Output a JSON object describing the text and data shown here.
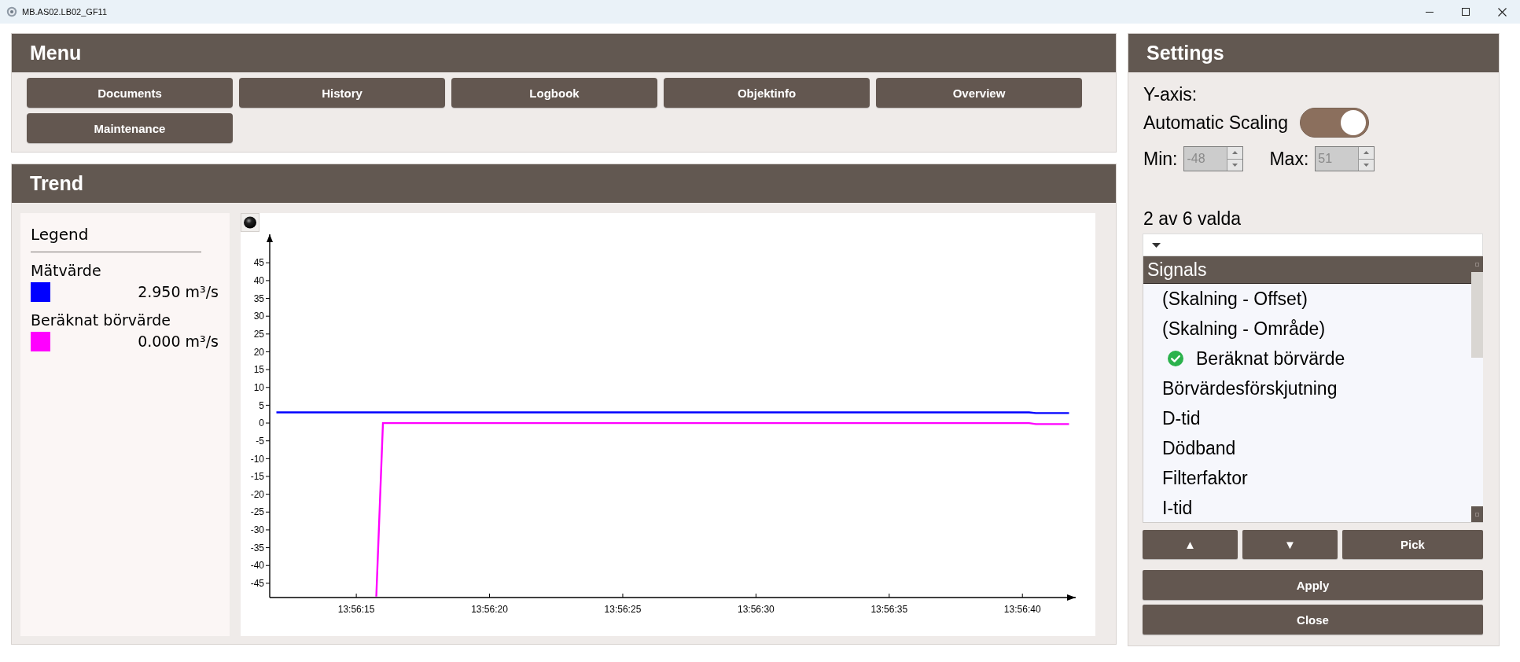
{
  "window": {
    "title": "MB.AS02.LB02_GF11"
  },
  "menu": {
    "title": "Menu",
    "buttons": [
      "Documents",
      "History",
      "Logbook",
      "Objektinfo",
      "Overview",
      "Maintenance"
    ]
  },
  "trend": {
    "title": "Trend",
    "legend": {
      "title": "Legend",
      "items": [
        {
          "name": "Mätvärde",
          "color": "#0000ff",
          "value": "2.950 m³/s"
        },
        {
          "name": "Beräknat börvärde",
          "color": "#ff00ff",
          "value": "0.000 m³/s"
        }
      ]
    },
    "chart_data": {
      "type": "line",
      "categories": [
        null,
        null,
        null,
        null,
        null,
        null,
        null,
        null,
        null,
        null,
        null,
        null,
        "13:56:15",
        null,
        null,
        null,
        null,
        null,
        null,
        null,
        null,
        null,
        null,
        null,
        null,
        null,
        null,
        null,
        null,
        null,
        null,
        null,
        "13:56:20",
        null,
        null,
        null,
        null,
        null,
        null,
        null,
        null,
        null,
        null,
        null,
        null,
        null,
        null,
        null,
        null,
        null,
        null,
        null,
        "13:56:25",
        null,
        null,
        null,
        null,
        null,
        null,
        null,
        null,
        null,
        null,
        null,
        null,
        null,
        null,
        null,
        null,
        null,
        null,
        null,
        "13:56:30",
        null,
        null,
        null,
        null,
        null,
        null,
        null,
        null,
        null,
        null,
        null,
        null,
        null,
        null,
        null,
        null,
        null,
        null,
        null,
        "13:56:35",
        null,
        null,
        null,
        null,
        null,
        null,
        null,
        null,
        null,
        null,
        null,
        null,
        null,
        null,
        null,
        null,
        null,
        null,
        null,
        "13:56:40",
        null,
        null,
        null,
        null,
        null,
        null,
        null,
        null
      ],
      "series": [
        {
          "color": "#0000ff",
          "values": [
            3,
            3,
            3,
            3,
            3,
            3,
            3,
            3,
            3,
            3,
            3,
            3,
            3,
            3,
            3,
            3,
            3,
            3,
            3,
            3,
            3,
            3,
            3,
            3,
            3,
            3,
            3,
            3,
            3,
            3,
            3,
            3,
            3,
            3,
            3,
            3,
            3,
            3,
            3,
            3,
            3,
            3,
            3,
            3,
            3,
            3,
            3,
            3,
            3,
            3,
            3,
            3,
            3,
            3,
            3,
            3,
            3,
            3,
            3,
            3,
            3,
            3,
            3,
            3,
            3,
            3,
            3,
            3,
            3,
            3,
            3,
            3,
            3,
            3,
            3,
            3,
            3,
            3,
            3,
            3,
            3,
            3,
            3,
            3,
            3,
            3,
            3,
            3,
            3,
            3,
            3,
            3,
            3,
            3,
            3,
            3,
            3,
            3,
            3,
            3,
            3,
            3,
            3,
            3,
            3,
            3,
            3,
            3,
            3,
            3,
            3,
            3,
            3,
            3,
            2.8,
            2.8,
            2.8,
            2.8,
            2.8,
            2.8,
            null
          ]
        },
        {
          "color": "#ff00ff",
          "values": [
            null,
            null,
            null,
            null,
            null,
            null,
            null,
            null,
            null,
            null,
            null,
            null,
            null,
            null,
            null,
            -49,
            0,
            0,
            0,
            0,
            0,
            0,
            0,
            0,
            0,
            0,
            0,
            0,
            0,
            0,
            0,
            0,
            0,
            0,
            0,
            0,
            0,
            0,
            0,
            0,
            0,
            0,
            0,
            0,
            0,
            0,
            0,
            0,
            0,
            0,
            0,
            0,
            0,
            0,
            0,
            0,
            0,
            0,
            0,
            0,
            0,
            0,
            0,
            0,
            0,
            0,
            0,
            0,
            0,
            0,
            0,
            0,
            0,
            0,
            0,
            0,
            0,
            0,
            0,
            0,
            0,
            0,
            0,
            0,
            0,
            0,
            0,
            0,
            0,
            0,
            0,
            0,
            0,
            0,
            0,
            0,
            0,
            0,
            0,
            0,
            0,
            0,
            0,
            0,
            0,
            0,
            0,
            0,
            0,
            0,
            0,
            0,
            0,
            0,
            -0.3,
            -0.3,
            -0.3,
            -0.3,
            -0.3,
            -0.3,
            null
          ]
        }
      ],
      "ylim": [
        -49,
        53
      ],
      "yticks": [
        -45,
        -40,
        -35,
        -30,
        -25,
        -20,
        -15,
        -10,
        -5,
        0,
        5,
        10,
        15,
        20,
        25,
        30,
        35,
        40,
        45
      ]
    }
  },
  "settings": {
    "title": "Settings",
    "y_axis_label": "Y-axis:",
    "auto_scaling": {
      "label": "Automatic Scaling",
      "on": true
    },
    "min": {
      "label": "Min:",
      "value": "-48",
      "disabled": true
    },
    "max": {
      "label": "Max:",
      "value": "51",
      "disabled": true
    },
    "selection_count": "2 av 6 valda",
    "signals": {
      "header": "Signals",
      "items": [
        {
          "label": "(Skalning - Offset)",
          "checked": false
        },
        {
          "label": "(Skalning - Område)",
          "checked": false
        },
        {
          "label": "Beräknat börvärde",
          "checked": true
        },
        {
          "label": "Börvärdesförskjutning",
          "checked": false
        },
        {
          "label": "D-tid",
          "checked": false
        },
        {
          "label": "Dödband",
          "checked": false
        },
        {
          "label": "Filterfaktor",
          "checked": false
        },
        {
          "label": "I-tid",
          "checked": false
        }
      ]
    },
    "list_buttons": [
      "▲",
      "▼",
      "Pick"
    ],
    "apply": "Apply",
    "close": "Close"
  }
}
